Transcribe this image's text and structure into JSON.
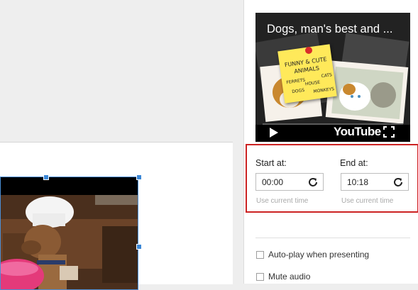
{
  "video_card": {
    "title": "Dogs, man's best and ...",
    "brand": "YouTube",
    "note_lines": [
      "FUNNY & CUTE",
      "ANIMALS",
      "FERRETS",
      "CATS",
      "HOUSE",
      "DOGS",
      "MONKEYS"
    ]
  },
  "timing": {
    "start_label": "Start at:",
    "start_value": "00:00",
    "start_hint": "Use current time",
    "end_label": "End at:",
    "end_value": "10:18",
    "end_hint": "Use current time"
  },
  "options": {
    "autoplay_label": "Auto-play when presenting",
    "mute_label": "Mute audio"
  },
  "colors": {
    "highlight_border": "#cc2222",
    "selection_handle": "#3b87d6"
  }
}
